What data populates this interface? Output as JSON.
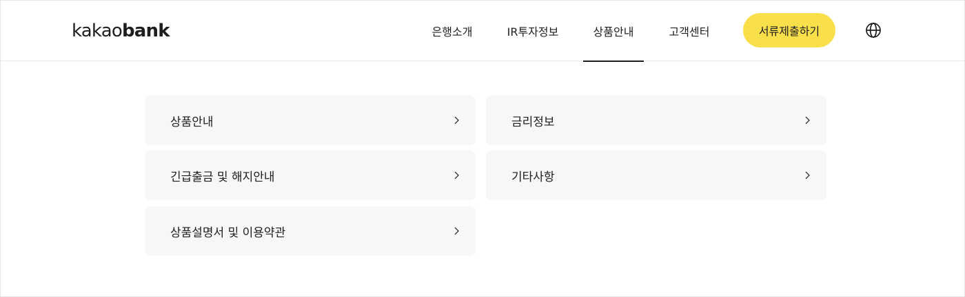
{
  "header": {
    "logo": {
      "light": "kakao",
      "bold": "bank"
    },
    "nav": [
      {
        "label": "은행소개",
        "active": false
      },
      {
        "label": "IR투자정보",
        "active": false
      },
      {
        "label": "상품안내",
        "active": true
      },
      {
        "label": "고객센터",
        "active": false
      }
    ],
    "submit_button": "서류제출하기",
    "language_icon": "globe-icon",
    "accent_color": "#f9e04b"
  },
  "menu": {
    "cards": [
      {
        "label": "상품안내",
        "icon": "chevron-right-icon"
      },
      {
        "label": "금리정보",
        "icon": "chevron-right-icon"
      },
      {
        "label": "긴급출금 및 해지안내",
        "icon": "chevron-right-icon"
      },
      {
        "label": "기타사항",
        "icon": "chevron-right-icon"
      },
      {
        "label": "상품설명서 및 이용약관",
        "icon": "chevron-right-icon"
      }
    ]
  }
}
